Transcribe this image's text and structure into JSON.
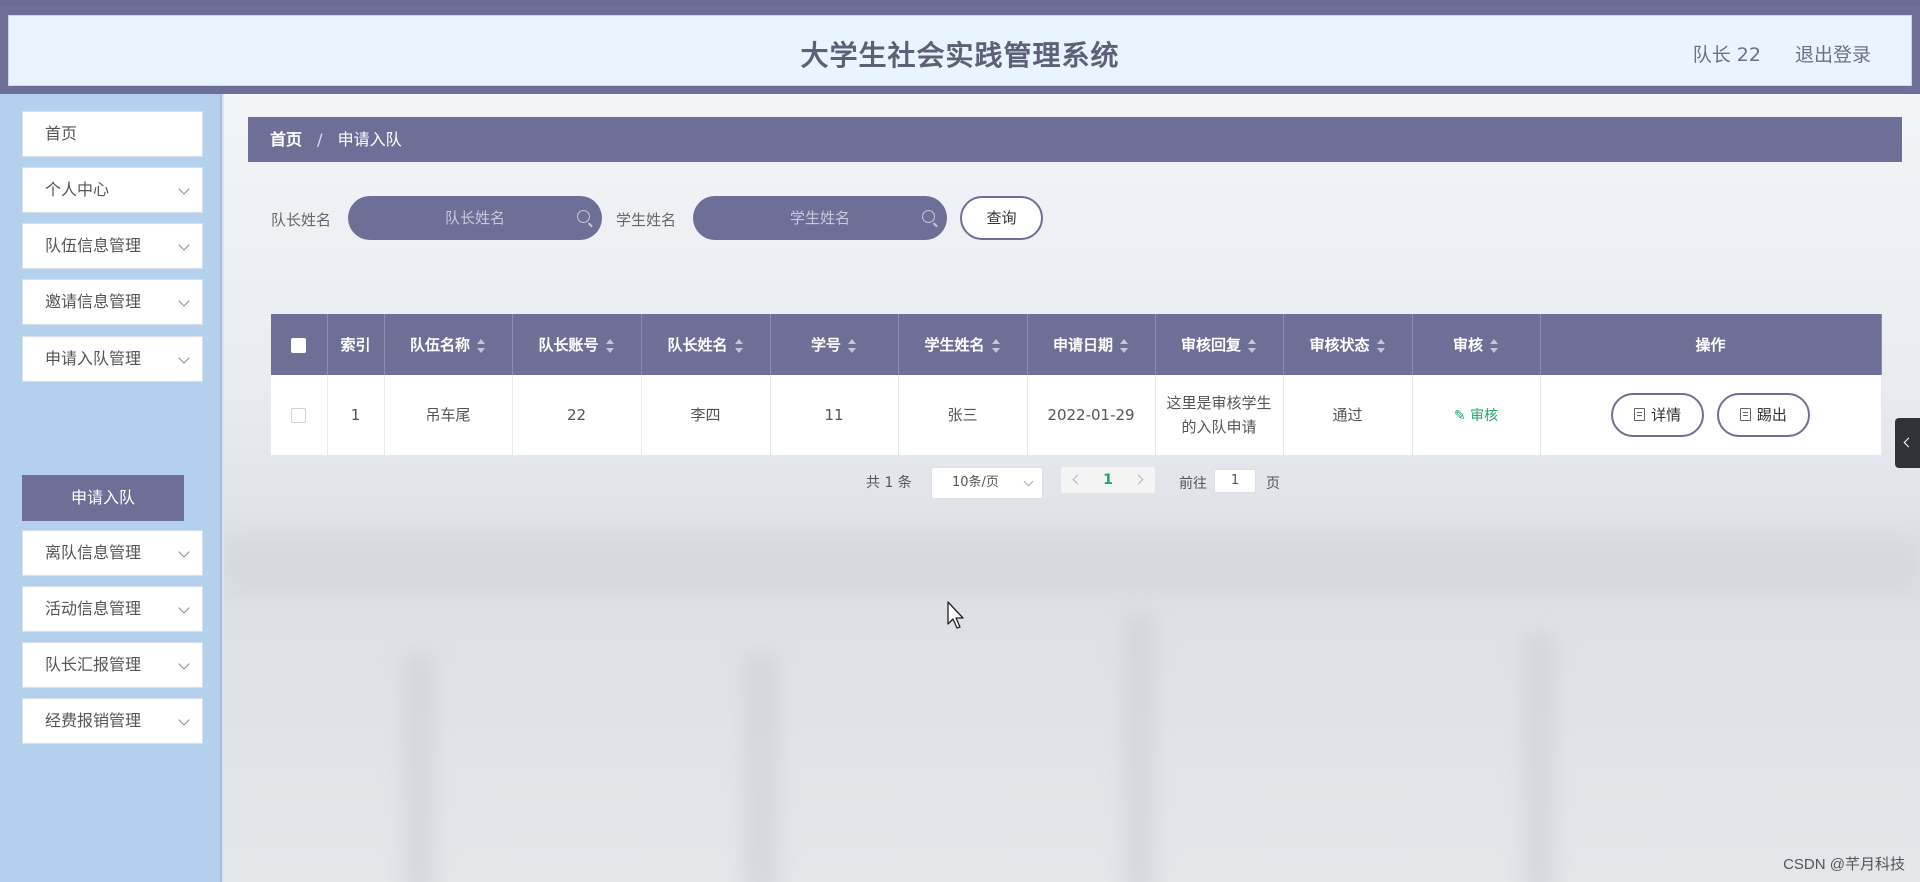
{
  "header": {
    "title": "大学生社会实践管理系统",
    "user": "队长 22",
    "logout": "退出登录"
  },
  "sidebar": {
    "items": [
      {
        "label": "首页",
        "has_chevron": false
      },
      {
        "label": "个人中心",
        "has_chevron": true
      },
      {
        "label": "队伍信息管理",
        "has_chevron": true
      },
      {
        "label": "邀请信息管理",
        "has_chevron": true
      },
      {
        "label": "申请入队管理",
        "has_chevron": true
      },
      {
        "label": "离队信息管理",
        "has_chevron": true
      },
      {
        "label": "活动信息管理",
        "has_chevron": true
      },
      {
        "label": "队长汇报管理",
        "has_chevron": true
      },
      {
        "label": "经费报销管理",
        "has_chevron": true
      }
    ],
    "active_submenu": "申请入队"
  },
  "breadcrumb": {
    "home": "首页",
    "separator": "/",
    "current": "申请入队"
  },
  "search": {
    "captain_label": "队长姓名",
    "captain_placeholder": "队长姓名",
    "student_label": "学生姓名",
    "student_placeholder": "学生姓名",
    "query_button": "查询"
  },
  "table": {
    "columns": [
      "索引",
      "队伍名称",
      "队长账号",
      "队长姓名",
      "学号",
      "学生姓名",
      "申请日期",
      "审核回复",
      "审核状态",
      "审核",
      "操作"
    ],
    "sortable": [
      false,
      true,
      true,
      true,
      true,
      true,
      true,
      true,
      true,
      true,
      false
    ],
    "rows": [
      {
        "index": "1",
        "team_name": "吊车尾",
        "captain_account": "22",
        "captain_name": "李四",
        "student_id": "11",
        "student_name": "张三",
        "apply_date": "2022-01-29",
        "reply": "这里是审核学生的入队申请",
        "status": "通过",
        "audit": "审核",
        "detail_button": "详情",
        "kick_button": "踢出"
      }
    ]
  },
  "pagination": {
    "total": "共 1 条",
    "page_size": "10条/页",
    "current_page": "1",
    "goto_label": "前往",
    "goto_value": "1",
    "page_label": "页"
  },
  "watermark": "CSDN @芊月科技",
  "colors": {
    "accent": "#6e6f96",
    "sidebar_bg": "#b3d0ec",
    "header_bg": "#e8f4ff",
    "link_green": "#1fa86a"
  }
}
